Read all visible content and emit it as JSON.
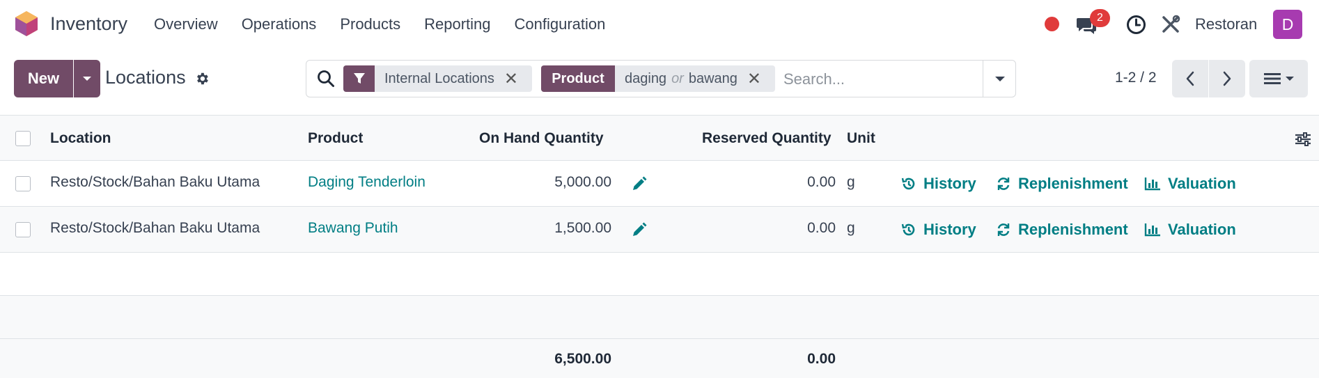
{
  "navbar": {
    "app_name": "Inventory",
    "menu": [
      "Overview",
      "Operations",
      "Products",
      "Reporting",
      "Configuration"
    ],
    "chat_badge": "2",
    "company": "Restoran",
    "avatar_initial": "D",
    "colors": {
      "brand": "#714b67",
      "link": "#017e84",
      "alert": "#e03b3b",
      "avatar": "#a73bb0"
    }
  },
  "control_panel": {
    "new_label": "New",
    "title": "Locations",
    "search": {
      "facet_filter_value": "Internal Locations",
      "facet_product_label": "Product",
      "facet_product_value_1": "daging",
      "facet_product_or": "or",
      "facet_product_value_2": "bawang",
      "placeholder": "Search..."
    },
    "pager": "1-2 / 2"
  },
  "table": {
    "headers": {
      "location": "Location",
      "product": "Product",
      "on_hand": "On Hand Quantity",
      "reserved": "Reserved Quantity",
      "unit": "Unit"
    },
    "rows": [
      {
        "location": "Resto/Stock/Bahan Baku Utama",
        "product": "Daging Tenderloin",
        "on_hand": "5,000.00",
        "reserved": "0.00",
        "unit": "g",
        "history": "History",
        "replenishment": "Replenishment",
        "valuation": "Valuation"
      },
      {
        "location": "Resto/Stock/Bahan Baku Utama",
        "product": "Bawang Putih",
        "on_hand": "1,500.00",
        "reserved": "0.00",
        "unit": "g",
        "history": "History",
        "replenishment": "Replenishment",
        "valuation": "Valuation"
      }
    ],
    "totals": {
      "on_hand": "6,500.00",
      "reserved": "0.00"
    }
  }
}
